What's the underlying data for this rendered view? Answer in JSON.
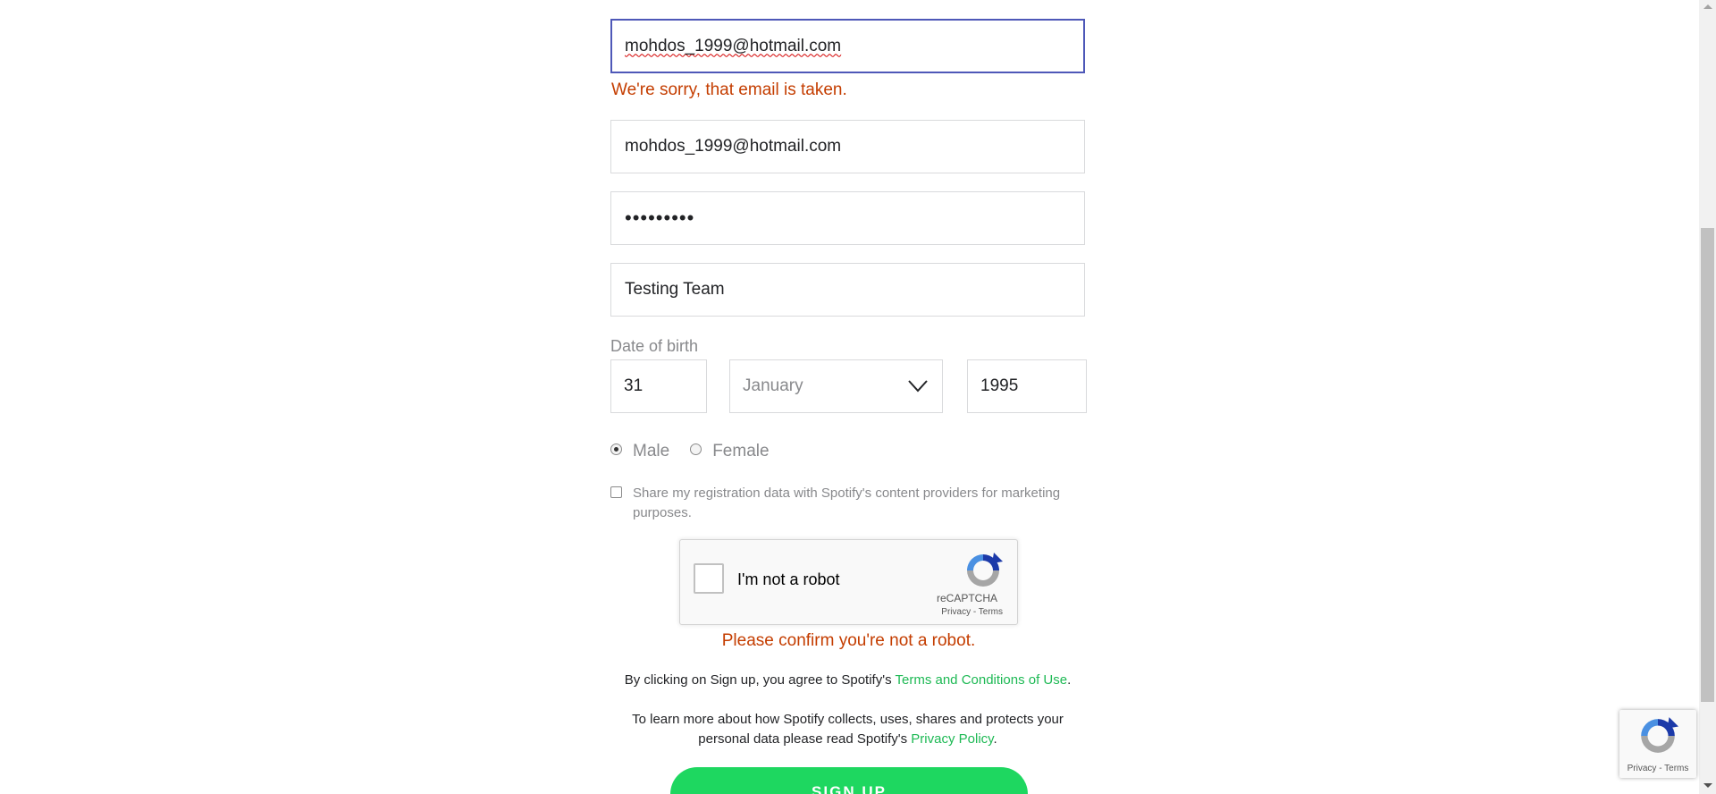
{
  "form": {
    "email_value": "mohdos_1999@hotmail.com",
    "email_error": "We're sorry, that email is taken.",
    "confirm_email_value": "mohdos_1999@hotmail.com",
    "password_mask": "•••••••••",
    "profile_name_value": "Testing Team",
    "dob_label": "Date of birth",
    "dob_day": "31",
    "dob_month": "January",
    "dob_year": "1995",
    "gender_male": "Male",
    "gender_female": "Female",
    "share_label": "Share my registration data with Spotify's content providers for marketing purposes.",
    "captcha_label": "I'm not a robot",
    "captcha_brand": "reCAPTCHA",
    "captcha_links": "Privacy - Terms",
    "captcha_error": "Please confirm you're not a robot.",
    "terms_prefix": "By clicking on Sign up, you agree to Spotify's",
    "terms_link": "Terms and Conditions of Use",
    "terms_suffix": ".",
    "privacy_prefix": "To learn more about how Spotify collects, uses, shares and protects your personal data please read Spotify's",
    "privacy_link": "Privacy Policy",
    "privacy_suffix": ".",
    "signup_label": "SIGN UP"
  },
  "recaptcha_badge": {
    "links": "Privacy - Terms"
  },
  "colors": {
    "error": "#c43d00",
    "link": "#1db954",
    "signup_bg": "#1ed760",
    "focus_border": "#4e58b8"
  }
}
